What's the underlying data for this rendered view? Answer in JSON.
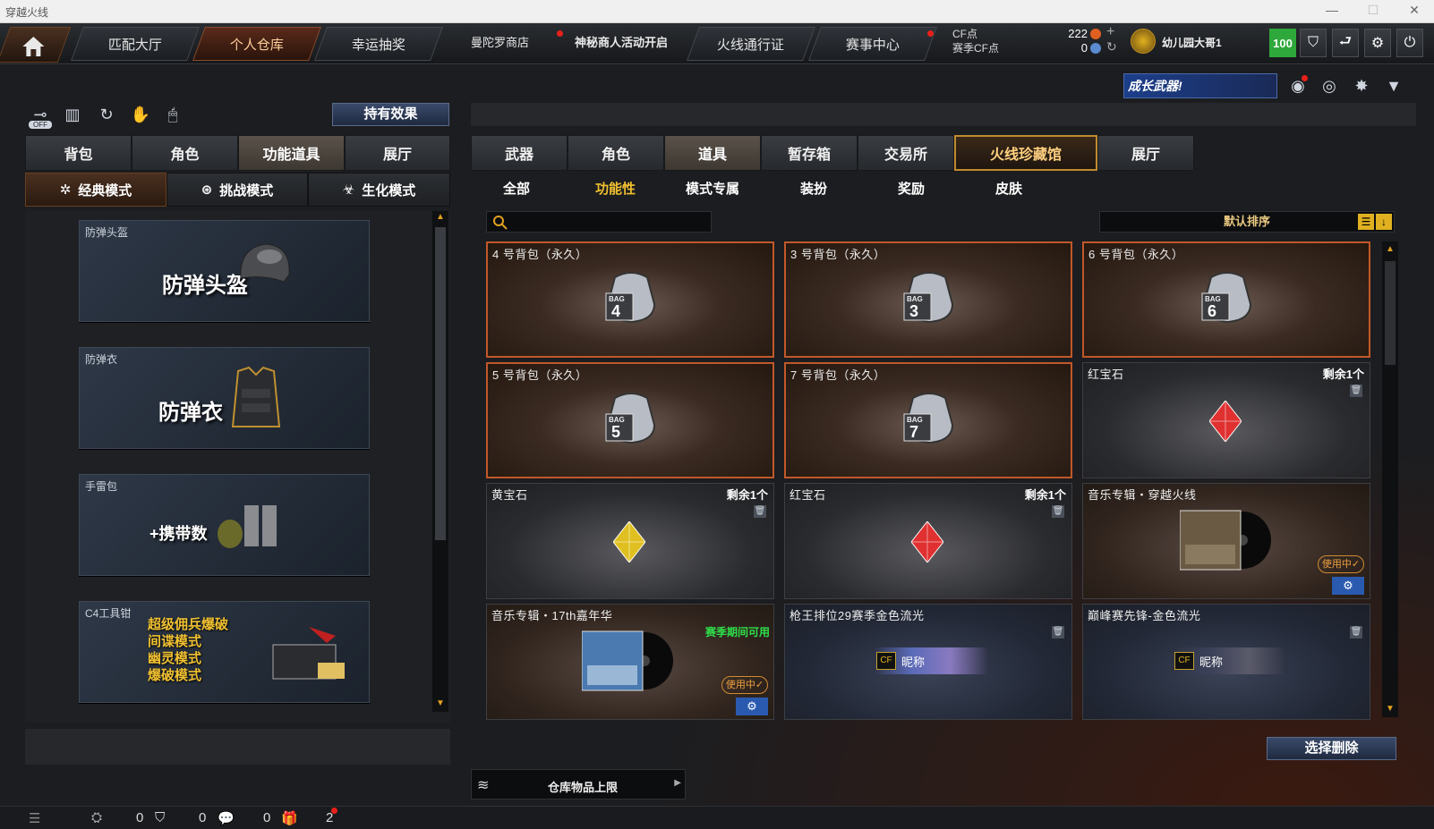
{
  "window": {
    "title": "穿越火线",
    "min": "—",
    "max": "☐",
    "close": "✕"
  },
  "topnav": {
    "tabs": [
      {
        "label": "匹配大厅"
      },
      {
        "label": "个人仓库"
      },
      {
        "label": "幸运抽奖"
      }
    ],
    "links": [
      {
        "label": "曼陀罗商店"
      },
      {
        "label": "神秘商人活动开启"
      }
    ],
    "tabs2": [
      {
        "label": "火线通行证"
      },
      {
        "label": "赛事中心"
      }
    ],
    "cf_label": "CF点",
    "season_cf_label": "赛季CF点",
    "cf_value": "222",
    "season_cf_value": "0",
    "add_icon": "+",
    "refresh_icon": "↻",
    "username": "幼儿园大哥1",
    "level": "100"
  },
  "banner": {
    "text": "成长武器!"
  },
  "left": {
    "effect_button": "持有效果",
    "tool_icons": [
      "off-toggle-icon",
      "ranking-icon",
      "history-icon",
      "hand-icon",
      "mouse-icon"
    ],
    "off_text": "OFF",
    "tabs": [
      {
        "label": "背包"
      },
      {
        "label": "角色"
      },
      {
        "label": "功能道具"
      },
      {
        "label": "展厅"
      }
    ],
    "modes": [
      {
        "label": "经典模式"
      },
      {
        "label": "挑战模式"
      },
      {
        "label": "生化模式"
      }
    ],
    "items": [
      {
        "label": "防弹头盔",
        "big": "防弹头盔"
      },
      {
        "label": "防弹衣",
        "big": "防弹衣"
      },
      {
        "label": "手雷包",
        "big": "+携带数"
      },
      {
        "label": "C4工具钳",
        "lines": [
          "超级佣兵爆破",
          "间谍模式",
          "幽灵模式",
          "爆破模式"
        ]
      }
    ]
  },
  "right": {
    "tabs": [
      {
        "label": "武器"
      },
      {
        "label": "角色"
      },
      {
        "label": "道具"
      },
      {
        "label": "暂存箱"
      },
      {
        "label": "交易所"
      },
      {
        "label": "火线珍藏馆"
      },
      {
        "label": "展厅"
      }
    ],
    "filters": [
      {
        "label": "全部"
      },
      {
        "label": "功能性"
      },
      {
        "label": "模式专属"
      },
      {
        "label": "装扮"
      },
      {
        "label": "奖励"
      },
      {
        "label": "皮肤"
      }
    ],
    "sort_label": "默认排序",
    "grid": [
      {
        "name": "4 号背包（永久）",
        "bag": "4"
      },
      {
        "name": "3 号背包（永久）",
        "bag": "3"
      },
      {
        "name": "6 号背包（永久）",
        "bag": "6"
      },
      {
        "name": "5 号背包（永久）",
        "bag": "5"
      },
      {
        "name": "7 号背包（永久）",
        "bag": "7"
      },
      {
        "name": "红宝石",
        "remain": "剩余1个"
      },
      {
        "name": "黄宝石",
        "remain": "剩余1个"
      },
      {
        "name": "红宝石",
        "remain": "剩余1个"
      },
      {
        "name": "音乐专辑・穿越火线",
        "status": "使用中✓"
      },
      {
        "name": "音乐专辑・17th嘉年华",
        "season": "赛季期间可用",
        "status": "使用中✓"
      },
      {
        "name": "枪王排位29赛季金色流光",
        "nick": "昵称"
      },
      {
        "name": "巅峰赛先锋-金色流光",
        "nick": "昵称"
      }
    ],
    "bag_text": "BAG",
    "select_delete": "选择删除",
    "capacity": "仓库物品上限"
  },
  "statusbar": {
    "counts": [
      "0",
      "0",
      "0",
      "2"
    ]
  },
  "colors": {
    "accent": "#c0582a",
    "green": "#2ea83a",
    "gold": "#e0b020",
    "in_use": "#f0a040"
  }
}
